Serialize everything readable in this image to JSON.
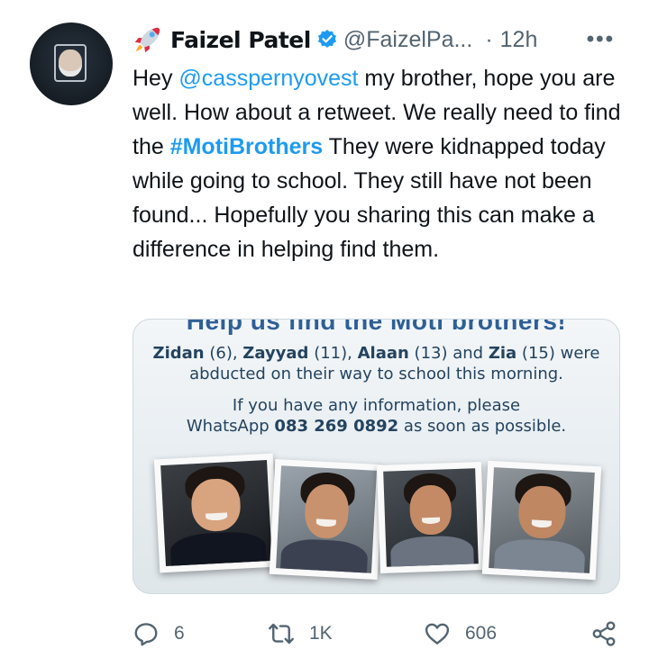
{
  "tweet": {
    "display_name": "Faizel Patel",
    "handle": "@FaizelPa...",
    "separator": "·",
    "time": "12h",
    "more_label": "•••",
    "text_parts": [
      "Hey ",
      "@casspernyovest",
      " my brother, hope you are well. How about a retweet. We really need to find the ",
      "#MotiBrothers",
      " They were kidnapped today while going to school. They still have not been found... Hopefully you sharing this can make a difference in helping find them."
    ]
  },
  "media": {
    "heading": "Help us find the Moti brothers!",
    "line1_names": [
      "Zidan",
      "Zayyad",
      "Alaan",
      "Zia"
    ],
    "line1_ages": [
      "(6), ",
      "(11), ",
      "(13) and ",
      "(15) were"
    ],
    "line2": "abducted on their way to school this morning.",
    "line3": "If you have any information, please",
    "line4_prefix": "WhatsApp ",
    "phone": "083 269 0892",
    "line4_suffix": " as soon as possible."
  },
  "actions": {
    "replies": "6",
    "retweets": "1K",
    "likes": "606"
  },
  "colors": {
    "link": "#1d9bf0",
    "verified": "#1d9bf0",
    "secondary_text": "#536471",
    "poster_heading": "#2f5f97"
  },
  "icons": [
    "rocket-icon",
    "verified-badge-icon",
    "more-icon",
    "reply-icon",
    "retweet-icon",
    "like-icon",
    "share-icon"
  ]
}
